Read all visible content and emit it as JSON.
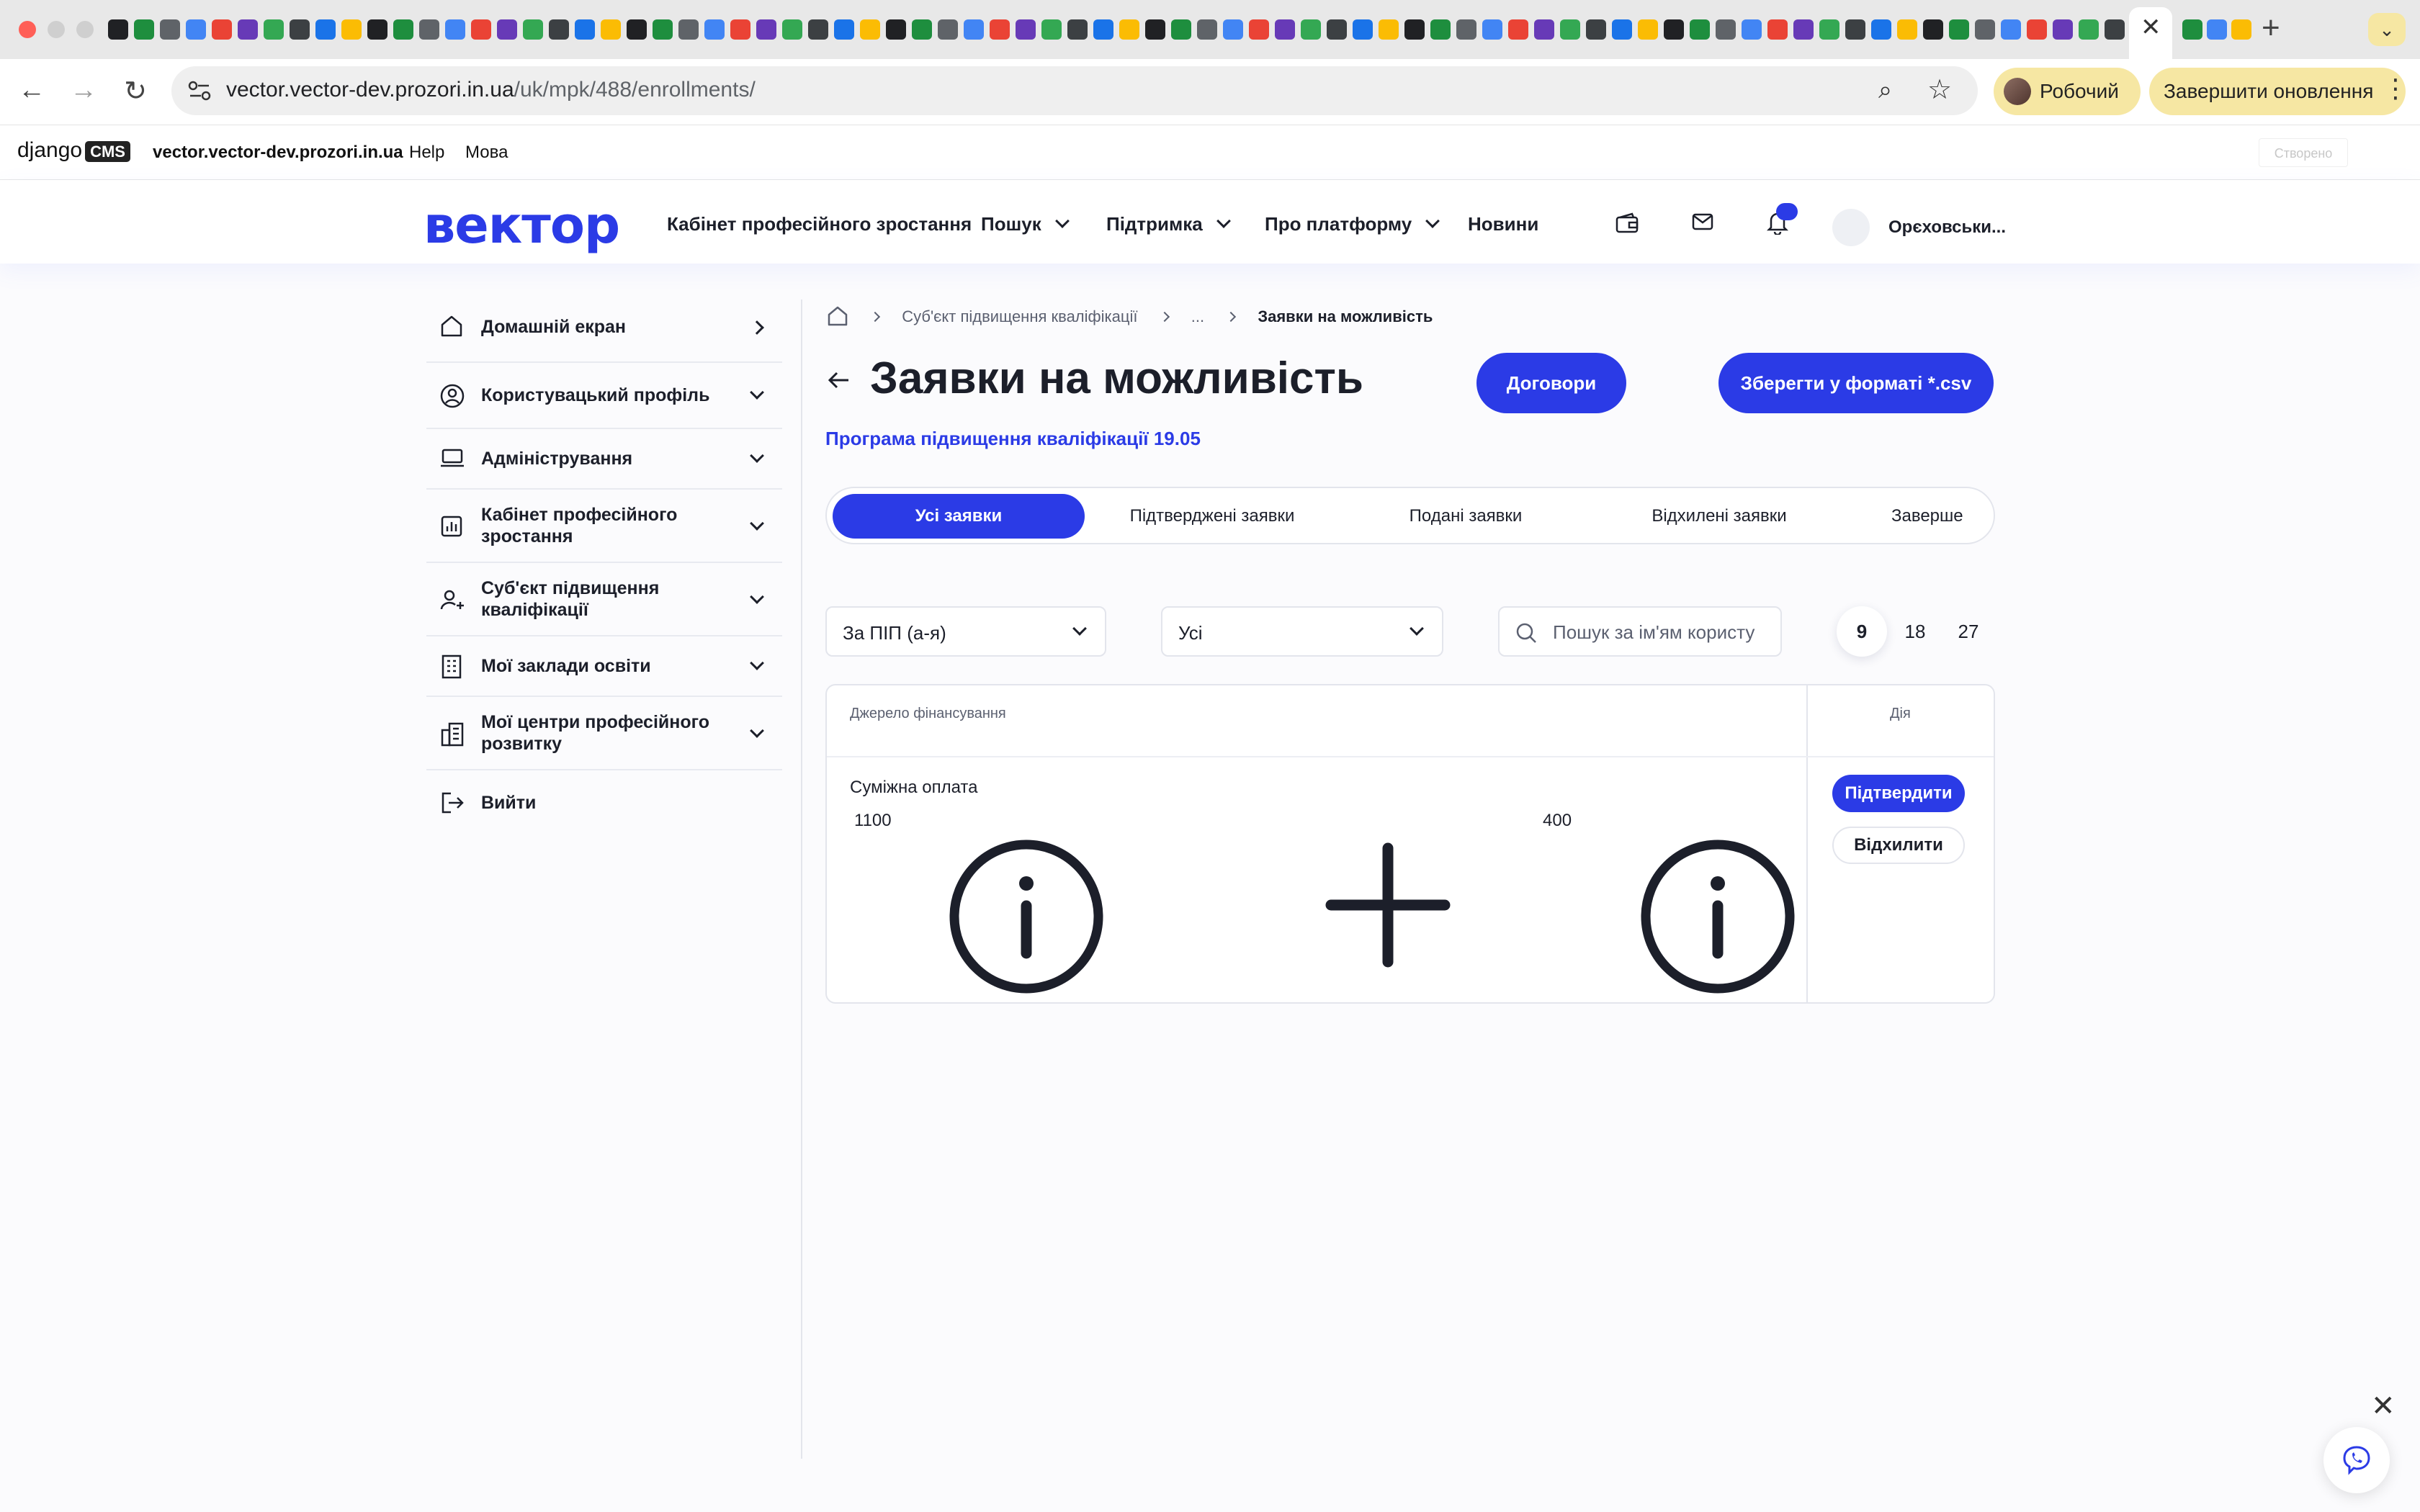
{
  "browser": {
    "url_host": "vector.vector-dev.prozori.in.ua",
    "url_path": "/uk/mpk/488/enrollments/",
    "profile_label": "Робочий",
    "update_label": "Завершити оновлення"
  },
  "cms_bar": {
    "logo": "django",
    "logo_badge": "CMS",
    "site": "vector.vector-dev.prozori.in.ua",
    "help": "Help",
    "language": "Мова",
    "created_button": "Створено"
  },
  "header": {
    "logo": "вектор",
    "nav": [
      {
        "label": "Кабінет професійного зростання",
        "has_dropdown": false
      },
      {
        "label": "Пошук",
        "has_dropdown": true
      },
      {
        "label": "Підтримка",
        "has_dropdown": true
      },
      {
        "label": "Про платформу",
        "has_dropdown": true
      },
      {
        "label": "Новини",
        "has_dropdown": false
      }
    ],
    "icons": [
      "wallet-icon",
      "mail-icon",
      "bell-icon"
    ],
    "user_name": "Орєховськи..."
  },
  "sidebar": {
    "items": [
      {
        "label": "Домашній екран",
        "icon": "home-icon",
        "arrow": "right"
      },
      {
        "label": "Користувацький профіль",
        "icon": "user-circle-icon",
        "arrow": "down"
      },
      {
        "label": "Адміністрування",
        "icon": "laptop-icon",
        "arrow": "down"
      },
      {
        "label": "Кабінет професійного зростання",
        "icon": "chart-icon",
        "arrow": "down"
      },
      {
        "label": "Суб'єкт підвищення кваліфікації",
        "icon": "user-plus-icon",
        "arrow": "down"
      },
      {
        "label": "Мої заклади освіти",
        "icon": "building-icon",
        "arrow": "down"
      },
      {
        "label": "Мої центри професійного розвитку",
        "icon": "office-icon",
        "arrow": "down"
      },
      {
        "label": "Вийти",
        "icon": "logout-icon",
        "arrow": ""
      }
    ]
  },
  "breadcrumb": {
    "items": [
      "Суб'єкт підвищення кваліфікації",
      "...",
      "Заявки на можливість"
    ]
  },
  "page": {
    "title": "Заявки на можливість",
    "subtitle": "Програма підвищення кваліфікації 19.05",
    "contracts_button": "Договори",
    "csv_button": "Зберегти у форматі *.csv"
  },
  "tabs": [
    "Усі заявки",
    "Підтверджені заявки",
    "Подані заявки",
    "Відхилені заявки",
    "Заверше"
  ],
  "filters": {
    "sort_value": "За ПІП (а-я)",
    "status_value": "Усі",
    "search_placeholder": "Пошук за ім'ям користу",
    "page_sizes": [
      "9",
      "18",
      "27"
    ],
    "page_size_selected": "9"
  },
  "table": {
    "headers": {
      "funding": "Джерело фінансування",
      "action": "Дія"
    },
    "rows": [
      {
        "funding": "Суміжна оплата",
        "amount_1": "1100",
        "amount_2": "400",
        "confirm": "Підтвердити",
        "reject": "Відхилити"
      }
    ]
  },
  "colors": {
    "accent": "#2b3be6",
    "text": "#1c1f2a",
    "muted": "#5b6070",
    "border": "#e3e5ec"
  }
}
